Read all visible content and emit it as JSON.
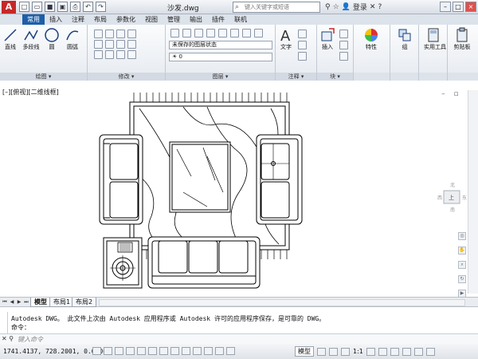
{
  "title_bar": {
    "app_logo": "A",
    "document_title": "沙发.dwg",
    "search_placeholder": "键入关键字或短语",
    "login_label": "登录",
    "window_buttons": [
      "–",
      "□",
      "×"
    ]
  },
  "ribbon_tabs": [
    {
      "label": "常用",
      "active": true
    },
    {
      "label": "插入",
      "active": false
    },
    {
      "label": "注释",
      "active": false
    },
    {
      "label": "布局",
      "active": false
    },
    {
      "label": "参数化",
      "active": false
    },
    {
      "label": "视图",
      "active": false
    },
    {
      "label": "管理",
      "active": false
    },
    {
      "label": "输出",
      "active": false
    },
    {
      "label": "插件",
      "active": false
    },
    {
      "label": "联机",
      "active": false
    }
  ],
  "ribbon": {
    "draw_panel": {
      "label": "绘图 ▾",
      "tools": [
        "直线",
        "多段线",
        "圆",
        "圆弧"
      ]
    },
    "modify_panel": {
      "label": "修改 ▾"
    },
    "layers_panel": {
      "label": "图层 ▾",
      "layer_state": "未保存的图层状态",
      "current_layer": "0"
    },
    "annotation_panel": {
      "label": "注释 ▾",
      "text_tool": "文字"
    },
    "block_panel": {
      "label": "块 ▾",
      "insert_tool": "插入"
    },
    "properties_tool": "特性",
    "group_tool": "组",
    "utilities_tool": "实用工具",
    "clipboard_tool": "剪贴板"
  },
  "viewport": {
    "label": "[–][俯视][二维线框]",
    "controls": "– ▫ ×",
    "viewcube_face": "上"
  },
  "layout_tabs": [
    {
      "label": "模型",
      "active": true
    },
    {
      "label": "布局1",
      "active": false
    },
    {
      "label": "布局2",
      "active": false
    }
  ],
  "command_line": {
    "history_1": "Autodesk DWG。  此文件上次由 Autodesk 应用程序或 Autodesk 许可的应用程序保存，是可靠的 DWG。",
    "history_2": "命令：",
    "input_placeholder": "键入命令"
  },
  "status_bar": {
    "coordinates": "1741.4137, 728.2001, 0.0000",
    "model_button": "模型",
    "annotation_scale": "1:1"
  },
  "colors": {
    "accent": "#1d5fa8",
    "app_logo": "#c62828"
  }
}
